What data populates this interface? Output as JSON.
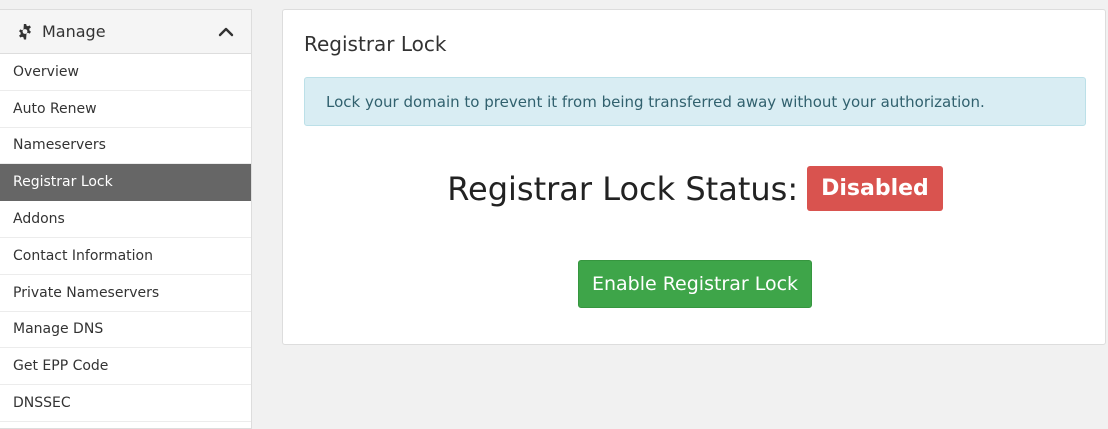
{
  "sidebar": {
    "header_title": "Manage",
    "items": [
      {
        "label": "Overview"
      },
      {
        "label": "Auto Renew"
      },
      {
        "label": "Nameservers"
      },
      {
        "label": "Registrar Lock"
      },
      {
        "label": "Addons"
      },
      {
        "label": "Contact Information"
      },
      {
        "label": "Private Nameservers"
      },
      {
        "label": "Manage DNS"
      },
      {
        "label": "Get EPP Code"
      },
      {
        "label": "DNSSEC"
      }
    ],
    "active_item": "Registrar Lock"
  },
  "panel": {
    "title": "Registrar Lock",
    "alert_text": "Lock your domain to prevent it from being transferred away without your authorization.",
    "status_label": "Registrar Lock Status:",
    "status_value": "Disabled",
    "action_button": "Enable Registrar Lock"
  },
  "colors": {
    "active_menu_bg": "#666666",
    "status_badge": "#d9534f",
    "action_button": "#3ea549",
    "alert_bg": "#d9edf3"
  },
  "icons": {
    "header": "gear-icon",
    "collapse": "chevron-up-icon"
  }
}
